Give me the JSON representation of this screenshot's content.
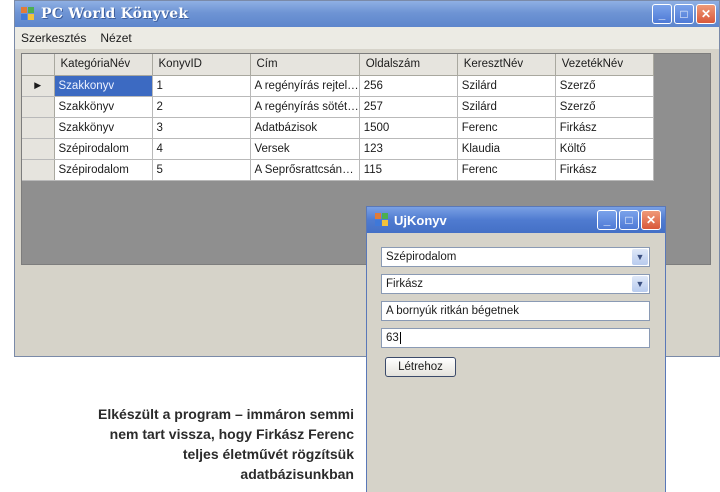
{
  "window": {
    "title": "PC World Könyvek"
  },
  "menu": {
    "items": [
      "Szerkesztés",
      "Nézet"
    ]
  },
  "grid": {
    "columns": [
      "KategóriaNév",
      "KonyvID",
      "Cím",
      "Oldalszám",
      "KeresztNév",
      "VezetékNév"
    ],
    "rows": [
      [
        "Szakkonyv",
        "1",
        "A regényírás rejtel…",
        "256",
        "Szilárd",
        "Szerző"
      ],
      [
        "Szakkönyv",
        "2",
        "A regényírás sötét…",
        "257",
        "Szilárd",
        "Szerző"
      ],
      [
        "Szakkönyv",
        "3",
        "Adatbázisok",
        "1500",
        "Ferenc",
        "Firkász"
      ],
      [
        "Szépirodalom",
        "4",
        "Versek",
        "123",
        "Klaudia",
        "Költő"
      ],
      [
        "Szépirodalom",
        "5",
        "A Seprősrattcsán…",
        "115",
        "Ferenc",
        "Firkász"
      ]
    ],
    "current_row_marker": "▶"
  },
  "dialog": {
    "title": "UjKonyv",
    "category_value": "Szépirodalom",
    "author_value": "Firkász",
    "title_value": "A bornyúk ritkán bégetnek",
    "pages_value": "63",
    "create_button": "Létrehoz"
  },
  "caption": "Elkészült a program – immáron semmi nem tart vissza, hogy Firkász Ferenc teljes életművét rögzítsük adatbázisunkban"
}
